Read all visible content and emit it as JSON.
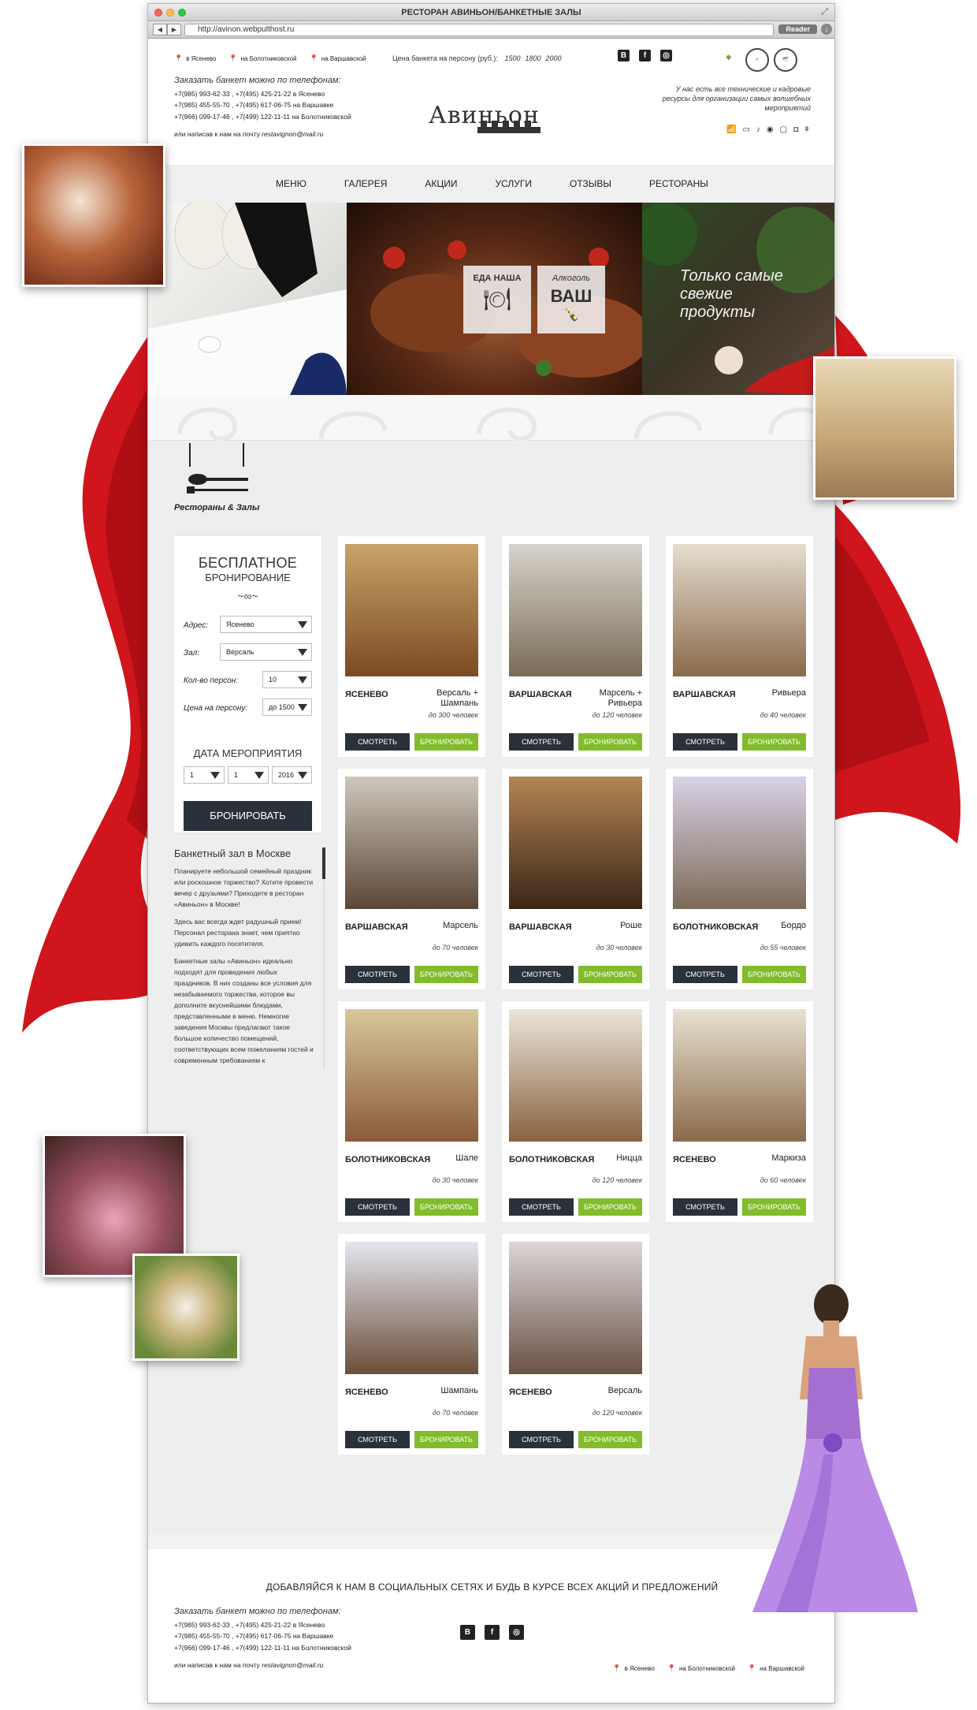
{
  "browser": {
    "title": "РЕСТОРАН АВИНЬОН/БАНКЕТНЫЕ ЗАЛЫ",
    "url": "http://avinon.webpulthost.ru",
    "reader_label": "Reader"
  },
  "header": {
    "addresses": [
      "в Ясенево",
      "на Болотниковской",
      "на Варшавской"
    ],
    "price_label": "Цена банкета на персону (руб.):",
    "prices": [
      "1500",
      "1800",
      "2000"
    ],
    "social": [
      "В",
      "f",
      "◎"
    ],
    "order_title": "Заказать банкет можно по телефонам:",
    "phones": [
      "+7(985) 993-62-33 , +7(495) 425-21-22 в Ясенево",
      "+7(985) 455-55-70 , +7(495) 617-06-75 на Варшавке",
      "+7(966) 099-17-46 , +7(499) 122-11-11 на Болотниковской"
    ],
    "email_prefix": "или написав к нам на почту",
    "email": "restavignon@mail.ru",
    "logo_text": "Авиньон",
    "resources": "У нас есть все технические и кадровые ресурсы для организации самых волшебных мероприятий"
  },
  "menu": [
    "МЕНЮ",
    "ГАЛЕРЕЯ",
    "АКЦИИ",
    "УСЛУГИ",
    "ОТЗЫВЫ",
    "РЕСТОРАНЫ"
  ],
  "hero": {
    "tag1_top": "ЕДА НАША",
    "tag2_top": "Алкоголь",
    "tag2_big": "ВАШ",
    "fresh": "Только самые свежие продукты"
  },
  "section_title": "Рестораны & Залы",
  "booking": {
    "title1": "БЕСПЛАТНОЕ",
    "title2": "БРОНИРОВАНИЕ",
    "address_label": "Адрес:",
    "address_value": "Ясенево",
    "hall_label": "Зал:",
    "hall_value": "Версаль",
    "persons_label": "Кол-во персон:",
    "persons_value": "10",
    "price_label": "Цена на персону:",
    "price_value": "до 1500",
    "date_title": "ДАТА МЕРОПРИЯТИЯ",
    "day": "1",
    "month": "1",
    "year": "2016",
    "button": "БРОНИРОВАТЬ"
  },
  "about": {
    "title": "Банкетный зал в Москве",
    "p1": "Планируете небольшой семейный праздник или роскошное торжество? Хотите провести вечер с друзьями? Приходите в ресторан «Авиньон» в Москве!",
    "p2": "Здесь вас всегда ждет радушный прием! Персонал ресторана знает, чем приятно удивить каждого посетителя.",
    "p3": "Банкетные залы «Авиньон» идеально подходят для проведения любых праздников. В них созданы все условия для незабываемого торжества, которое вы дополните вкуснейшими блюдами, представленными в меню. Немногие заведения Москвы предлагают такое большое количество помещений, соответствующих всем пожеланиям гостей и современным требованиям к"
  },
  "card_buttons": {
    "view": "СМОТРЕТЬ",
    "book": "БРОНИРОВАТЬ"
  },
  "cards": [
    {
      "location": "ЯСЕНЕВО",
      "hall": "Версаль + Шампань",
      "capacity": "до 300 человек",
      "c1": "#c8a36a",
      "c2": "#7b4a22"
    },
    {
      "location": "ВАРШАВСКАЯ",
      "hall": "Марсель + Ривьера",
      "capacity": "до 120 человек",
      "c1": "#d8d4cc",
      "c2": "#7a6b58"
    },
    {
      "location": "ВАРШАВСКАЯ",
      "hall": "Ривьера",
      "capacity": "до 40 человек",
      "c1": "#e6ddd0",
      "c2": "#8a6a4a"
    },
    {
      "location": "ВАРШАВСКАЯ",
      "hall": "Марсель",
      "capacity": "до 70 человек",
      "c1": "#cfc7bc",
      "c2": "#5a4636"
    },
    {
      "location": "ВАРШАВСКАЯ",
      "hall": "Роше",
      "capacity": "до 30 человек",
      "c1": "#b48552",
      "c2": "#3a2618"
    },
    {
      "location": "БОЛОТНИКОВСКАЯ",
      "hall": "Бордо",
      "capacity": "до 55 человек",
      "c1": "#d9d2e6",
      "c2": "#7c6a58"
    },
    {
      "location": "БОЛОТНИКОВСКАЯ",
      "hall": "Шале",
      "capacity": "до 30 человек",
      "c1": "#d8c89a",
      "c2": "#8a5a3a"
    },
    {
      "location": "БОЛОТНИКОВСКАЯ",
      "hall": "Ницца",
      "capacity": "до 120 человек",
      "c1": "#ece6da",
      "c2": "#8a6240"
    },
    {
      "location": "ЯСЕНЕВО",
      "hall": "Маркиза",
      "capacity": "до 60 человек",
      "c1": "#e8e2d2",
      "c2": "#8b6a4a"
    },
    {
      "location": "ЯСЕНЕВО",
      "hall": "Шампань",
      "capacity": "до 70 человек",
      "c1": "#e4e6f0",
      "c2": "#6b4f3a"
    },
    {
      "location": "ЯСЕНЕВО",
      "hall": "Версаль",
      "capacity": "до 120 человек",
      "c1": "#dcd6d8",
      "c2": "#6a5246"
    }
  ],
  "footer": {
    "title": "ДОБАВЛЯЙСЯ К НАМ В СОЦИАЛЬНЫХ СЕТЯХ И БУДЬ В КУРСЕ ВСЕХ АКЦИЙ И ПРЕДЛОЖЕНИЙ"
  },
  "colors": {
    "accent_green": "#82bc2c",
    "dark_button": "#2b313a",
    "pin_red": "#c7282d",
    "ribbon_red": "#d0151c"
  }
}
